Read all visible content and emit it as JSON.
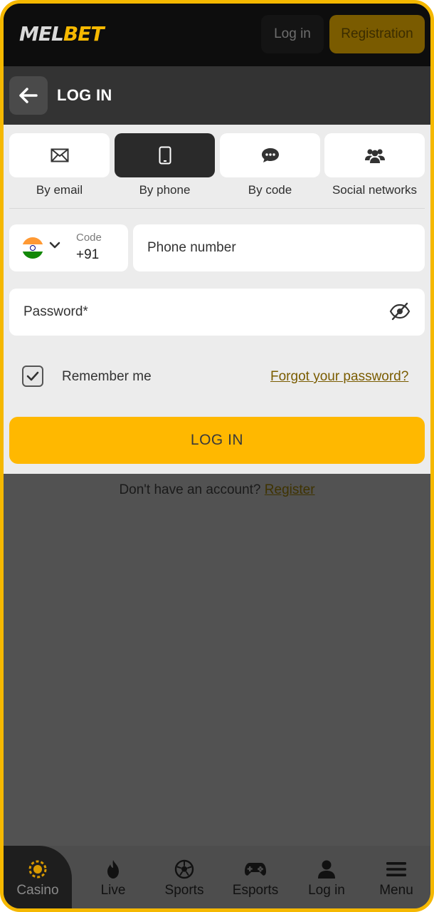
{
  "brand": {
    "logo_left": "MEL",
    "logo_right": "BET",
    "accent": "#ffb800"
  },
  "topbar": {
    "login_label": "Log in",
    "register_label": "Registration"
  },
  "header": {
    "title": "LOG IN",
    "back_icon": "arrow-left-icon"
  },
  "tabs": [
    {
      "label": "By email",
      "icon": "envelope-icon",
      "active": false
    },
    {
      "label": "By phone",
      "icon": "smartphone-icon",
      "active": true
    },
    {
      "label": "By code",
      "icon": "chat-bubble-icon",
      "active": false
    },
    {
      "label": "Social networks",
      "icon": "users-icon",
      "active": false
    }
  ],
  "phone": {
    "code_label": "Code",
    "code_value": "+91",
    "country_flag": "india-flag-icon",
    "placeholder": "Phone number"
  },
  "password": {
    "placeholder": "Password*",
    "toggle_icon": "eye-slash-icon"
  },
  "remember": {
    "label": "Remember me",
    "checked": true
  },
  "forgot": {
    "label": "Forgot your password?"
  },
  "submit": {
    "label": "LOG IN"
  },
  "signup": {
    "prompt": "Don't have an account?",
    "link": "Register"
  },
  "bottom_nav": [
    {
      "label": "Casino",
      "icon": "casino-chip-icon",
      "active": true
    },
    {
      "label": "Live",
      "icon": "flame-icon",
      "active": false
    },
    {
      "label": "Sports",
      "icon": "soccer-ball-icon",
      "active": false
    },
    {
      "label": "Esports",
      "icon": "gamepad-icon",
      "active": false
    },
    {
      "label": "Log in",
      "icon": "user-icon",
      "active": false
    },
    {
      "label": "Menu",
      "icon": "hamburger-menu-icon",
      "active": false
    }
  ]
}
